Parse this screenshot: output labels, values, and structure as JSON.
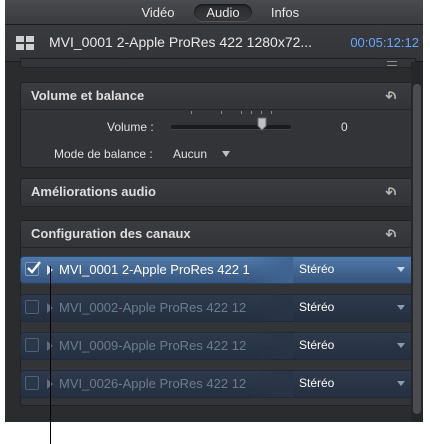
{
  "tabs": {
    "video": "Vidéo",
    "audio": "Audio",
    "infos": "Infos"
  },
  "header": {
    "icon": "filmstrip-icon",
    "title": "MVI_0001 2-Apple ProRes 422 1280x72...",
    "duration": "00:05:12:12"
  },
  "volume_section": {
    "title": "Volume et balance",
    "volume_label": "Volume :",
    "volume_value": "0",
    "balance_label": "Mode de balance :",
    "balance_value": "Aucun"
  },
  "enhancements_section": {
    "title": "Améliorations audio"
  },
  "channels_section": {
    "title": "Configuration des canaux",
    "rows": [
      {
        "name": "MVI_0001 2-Apple ProRes 422 1",
        "mode": "Stéréo",
        "checked": true,
        "active": true
      },
      {
        "name": "MVI_0002-Apple ProRes 422 12",
        "mode": "Stéréo",
        "checked": false,
        "active": false
      },
      {
        "name": "MVI_0009-Apple ProRes 422 12",
        "mode": "Stéréo",
        "checked": false,
        "active": false
      },
      {
        "name": "MVI_0026-Apple ProRes 422 12",
        "mode": "Stéréo",
        "checked": false,
        "active": false
      }
    ]
  },
  "colors": {
    "panel_bg": "#2b2c2e",
    "accent_timecode": "#63a7ff",
    "active_row": "#4a6f9c",
    "inactive_row": "#2a3546"
  }
}
